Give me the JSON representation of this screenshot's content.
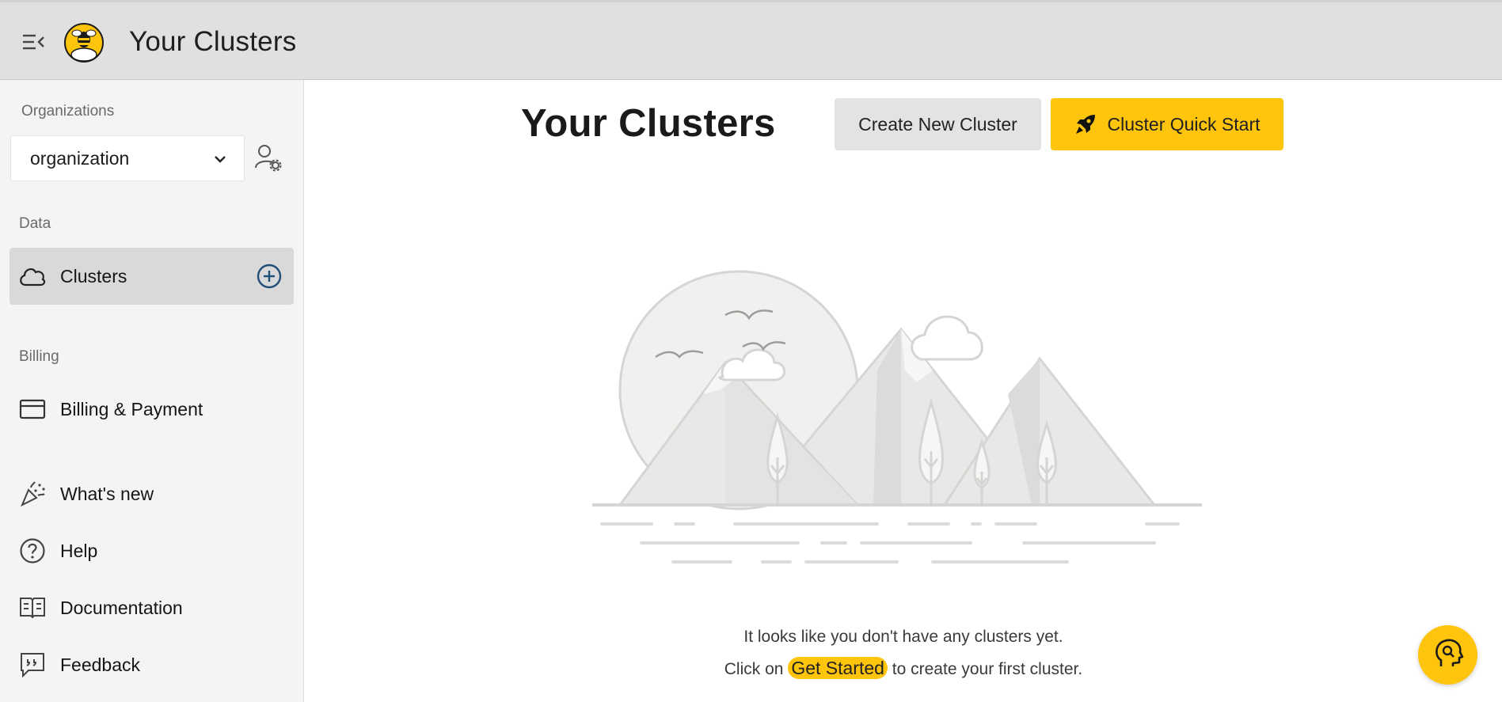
{
  "header": {
    "title": "Your Clusters",
    "menu_icon": "menu-collapse-icon",
    "logo_icon": "bee-logo"
  },
  "sidebar": {
    "organizations_label": "Organizations",
    "organization_value": "organization",
    "data_label": "Data",
    "billing_label": "Billing",
    "items": [
      {
        "label": "Clusters",
        "icon": "cloud-icon",
        "active": true
      },
      {
        "label": "Billing & Payment",
        "icon": "credit-card-icon"
      },
      {
        "label": "What's new",
        "icon": "party-popper-icon"
      },
      {
        "label": "Help",
        "icon": "help-circle-icon"
      },
      {
        "label": "Documentation",
        "icon": "book-icon"
      },
      {
        "label": "Feedback",
        "icon": "feedback-icon"
      }
    ]
  },
  "main": {
    "title": "Your Clusters",
    "create_button": "Create New Cluster",
    "quickstart_button": "Cluster Quick Start",
    "empty_line1": "It looks like you don't have any clusters yet.",
    "empty_line2_prefix": "Click on",
    "empty_line2_highlight": "Get Started",
    "empty_line2_suffix": "to create your first cluster."
  },
  "colors": {
    "accent": "#ffc40c",
    "topbar_bg": "#e0e0e0",
    "sidebar_bg": "#f4f4f4",
    "active_item_bg": "#d9d9d9",
    "add_icon": "#1f4e79"
  }
}
